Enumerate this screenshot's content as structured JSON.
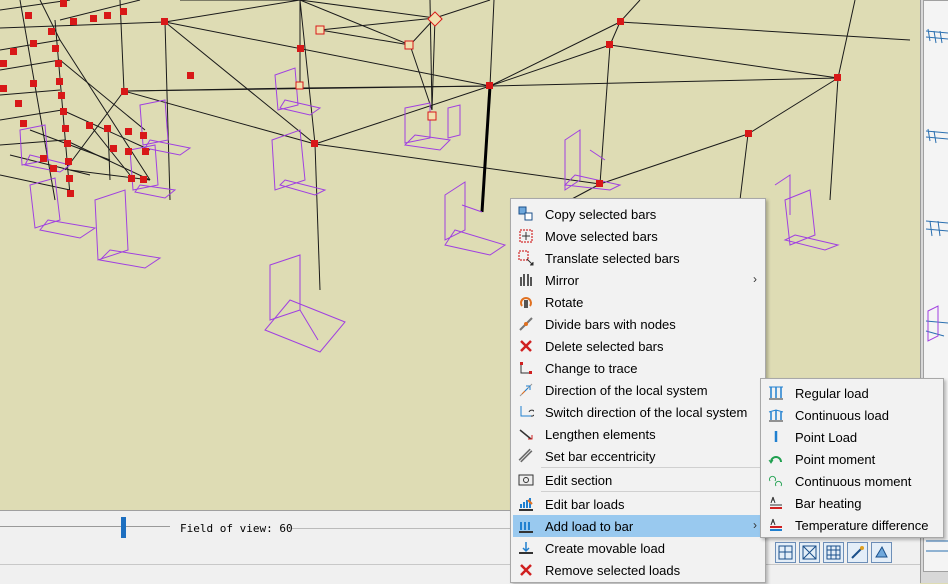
{
  "status_bar": {
    "field_of_view_label": "Field of view: 60",
    "field_of_view_value": 60
  },
  "context_menu": {
    "items": [
      {
        "label": "Copy selected bars",
        "icon": "copy-bars-icon"
      },
      {
        "label": "Move selected bars",
        "icon": "move-bars-icon"
      },
      {
        "label": "Translate selected bars",
        "icon": "translate-bars-icon"
      },
      {
        "label": "Mirror",
        "icon": "mirror-icon",
        "submenu_arrow": "›"
      },
      {
        "label": "Rotate",
        "icon": "rotate-icon"
      },
      {
        "label": "Divide bars with nodes",
        "icon": "divide-bars-icon"
      },
      {
        "label": "Delete selected bars",
        "icon": "delete-bars-icon"
      },
      {
        "label": "Change to trace",
        "icon": "trace-icon"
      },
      {
        "label": "Direction of the local system",
        "icon": "local-direction-icon"
      },
      {
        "label": "Switch direction of the local system",
        "icon": "switch-direction-icon"
      },
      {
        "label": "Lengthen elements",
        "icon": "lengthen-icon"
      },
      {
        "label": "Set bar eccentricity",
        "icon": "eccentricity-icon"
      },
      {
        "label": "Edit section",
        "icon": "edit-section-icon"
      },
      {
        "label": "Edit bar loads",
        "icon": "edit-loads-icon"
      },
      {
        "label": "Add load to bar",
        "icon": "add-load-icon",
        "submenu_arrow": "›",
        "highlighted": true
      },
      {
        "label": "Create movable load",
        "icon": "movable-load-icon"
      },
      {
        "label": "Remove selected loads",
        "icon": "remove-loads-icon"
      }
    ]
  },
  "submenu": {
    "items": [
      {
        "label": "Regular load",
        "icon": "regular-load-icon"
      },
      {
        "label": "Continuous load",
        "icon": "continuous-load-icon"
      },
      {
        "label": "Point Load",
        "icon": "point-load-icon"
      },
      {
        "label": "Point moment",
        "icon": "point-moment-icon"
      },
      {
        "label": "Continuous moment",
        "icon": "continuous-moment-icon"
      },
      {
        "label": "Bar heating",
        "icon": "bar-heating-icon"
      },
      {
        "label": "Temperature difference",
        "icon": "temperature-difference-icon"
      }
    ]
  },
  "colors": {
    "viewport_bg": "#dedcb4",
    "node": "#d81818",
    "support": "#a040e0",
    "bar": "#1a1a1a",
    "menu_highlight": "#99c9ef"
  }
}
